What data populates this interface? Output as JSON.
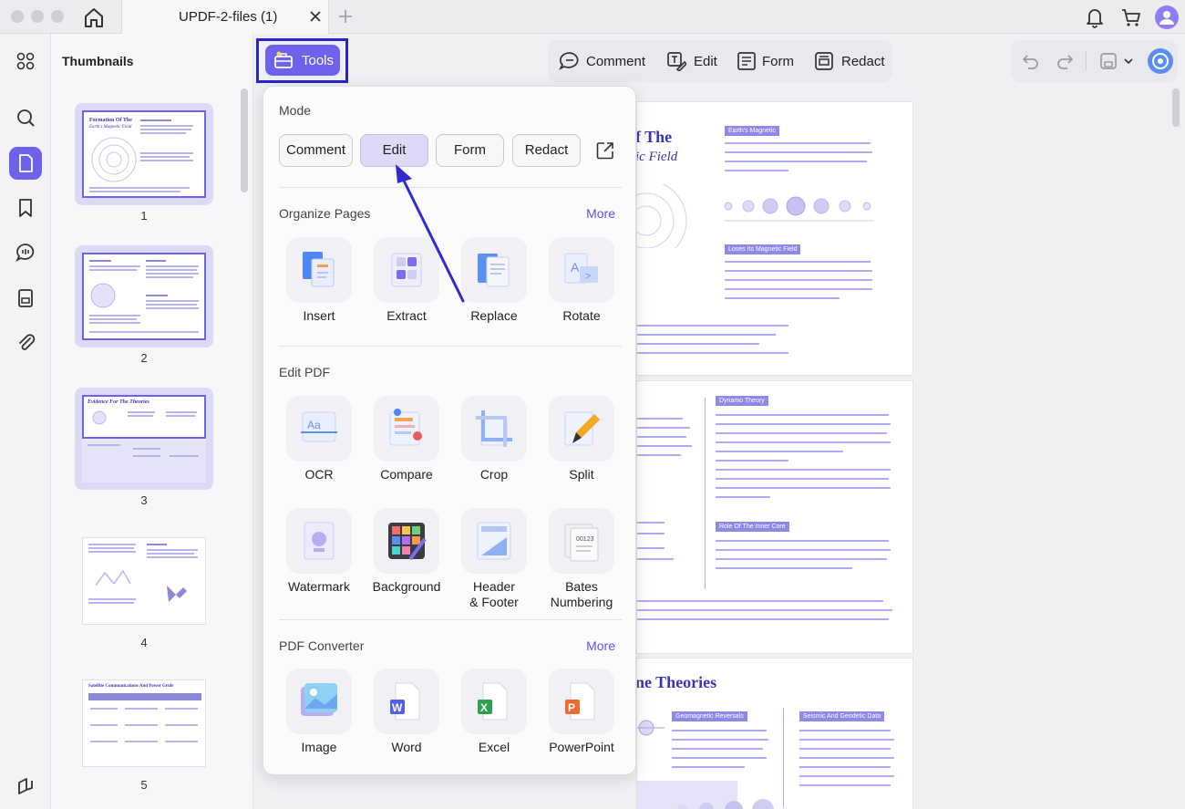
{
  "tab": {
    "title": "UPDF-2-files (1)"
  },
  "thumbnails": {
    "title": "Thumbnails",
    "pages": [
      {
        "number": "1",
        "heading": "Formation Of The",
        "subheading": "Earth's Magnetic Field"
      },
      {
        "number": "2"
      },
      {
        "number": "3",
        "heading": "Evidence For The Theories"
      },
      {
        "number": "4"
      },
      {
        "number": "5",
        "heading": "Satellite Communications And Power Grids"
      }
    ]
  },
  "toolbar": {
    "tools_label": "Tools",
    "modes": [
      "Comment",
      "Edit",
      "Form",
      "Redact"
    ]
  },
  "popover": {
    "mode_title": "Mode",
    "modes": [
      "Comment",
      "Edit",
      "Form",
      "Redact"
    ],
    "organize": {
      "title": "Organize Pages",
      "more": "More",
      "items": [
        "Insert",
        "Extract",
        "Replace",
        "Rotate"
      ]
    },
    "edit": {
      "title": "Edit PDF",
      "items": [
        "OCR",
        "Compare",
        "Crop",
        "Split",
        "Watermark",
        "Background",
        "Header\n& Footer",
        "Bates\nNumbering"
      ]
    },
    "converter": {
      "title": "PDF Converter",
      "more": "More",
      "items": [
        "Image",
        "Word",
        "Excel",
        "PowerPoint"
      ]
    }
  },
  "document": {
    "page1_heading": "f The",
    "page1_subheading": "ic Field",
    "page1_chip1": "Earth's Magnetic",
    "page1_chip2": "Loses Its Magnetic Field",
    "page2_chip1": "Dynamo Theory",
    "page2_chip2": "Role Of The Inner Core",
    "page3_heading": "ne Theories",
    "page3_chip1": "Geomagnetic Reversals",
    "page3_chip2": "Seismic And Geodetic Data"
  },
  "colors": {
    "accent": "#6e62ec",
    "highlight": "#2a25c8",
    "doc_text": "#3b35b5"
  }
}
